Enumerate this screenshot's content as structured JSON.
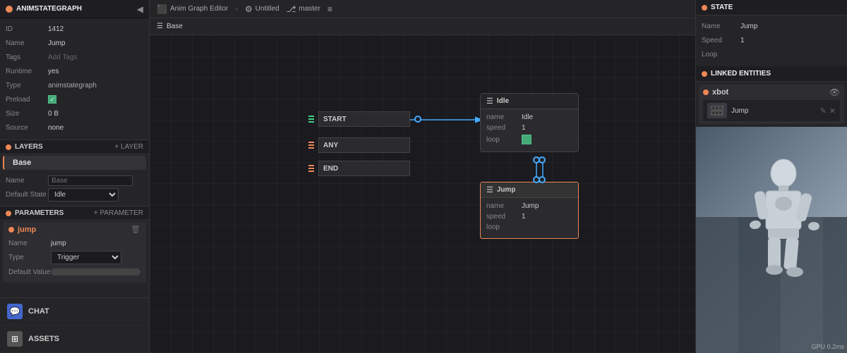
{
  "left": {
    "title": "ANIMSTATEGRAPH",
    "props": {
      "id_label": "ID",
      "id_value": "1412",
      "name_label": "Name",
      "name_value": "Jump",
      "tags_label": "Tags",
      "tags_placeholder": "Add Tags",
      "runtime_label": "Runtime",
      "runtime_value": "yes",
      "type_label": "Type",
      "type_value": "animstategraph",
      "preload_label": "Preload",
      "size_label": "Size",
      "size_value": "0 B",
      "source_label": "Source",
      "source_value": "none"
    },
    "layers_title": "LAYERS",
    "add_layer_label": "+ LAYER",
    "layers": [
      {
        "name": "Base",
        "active": true
      }
    ],
    "base_props": {
      "name_label": "Name",
      "name_placeholder": "Base",
      "default_state_label": "Default State",
      "default_state_value": "Idle"
    },
    "params_title": "PARAMETERS",
    "add_param_label": "+ PARAMETER",
    "params": [
      {
        "name": "jump",
        "name_label": "Name",
        "name_value": "jump",
        "type_label": "Type",
        "type_value": "Trigger",
        "default_label": "Default Value"
      }
    ]
  },
  "center": {
    "toolbar": {
      "anim_graph_editor": "Anim Graph Editor",
      "settings": "Untitled",
      "branch": "master"
    },
    "base_tab": "Base",
    "nodes": {
      "start": {
        "label": "START"
      },
      "any": {
        "label": "ANY"
      },
      "end": {
        "label": "END"
      },
      "idle": {
        "header": "Idle",
        "name_label": "name",
        "name_value": "Idle",
        "speed_label": "speed",
        "speed_value": "1",
        "loop_label": "loop"
      },
      "jump": {
        "header": "Jump",
        "name_label": "name",
        "name_value": "Jump",
        "speed_label": "speed",
        "speed_value": "1",
        "loop_label": "loop",
        "selected": true
      }
    },
    "bottom": {
      "chat_label": "CHAT",
      "assets_label": "ASSETS"
    }
  },
  "right": {
    "state_title": "STATE",
    "state_props": {
      "name_label": "Name",
      "name_value": "Jump",
      "speed_label": "Speed",
      "speed_value": "1",
      "loop_label": "Loop"
    },
    "linked_title": "LINKED ENTITIES",
    "entity": {
      "name": "xbot",
      "anim_name": "Jump"
    }
  },
  "preview": {
    "gpu_info": "GPU 0.2ms",
    "nav_info": "►  ■  ■"
  },
  "icons": {
    "menu": "☰",
    "settings": "⚙",
    "branch": "⎇",
    "list": "≡",
    "orange_dot": "●",
    "check": "✓",
    "eye": "👁",
    "trash": "🗑",
    "edit": "✎",
    "close": "✕",
    "grid": "#",
    "chat_icon": "💬"
  }
}
